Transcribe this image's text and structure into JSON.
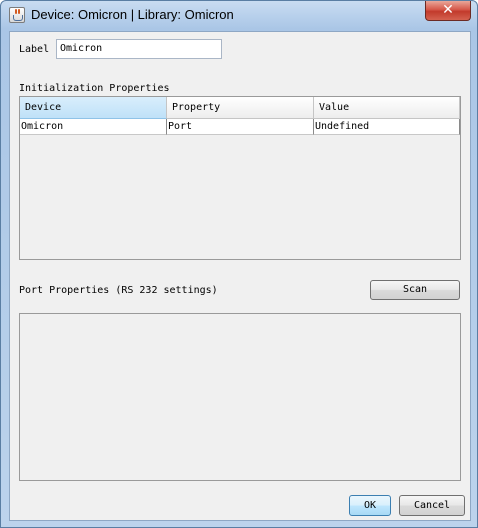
{
  "window": {
    "title": "Device: Omicron | Library: Omicron",
    "close_glyph": "✕"
  },
  "label_field": {
    "label": "Label",
    "value": "Omicron"
  },
  "init_props": {
    "heading": "Initialization Properties",
    "columns": [
      "Device",
      "Property",
      "Value"
    ],
    "rows": [
      [
        "Omicron",
        "Port",
        "Undefined"
      ]
    ]
  },
  "port_props": {
    "heading": "Port Properties (RS 232 settings)",
    "scan_label": "Scan"
  },
  "footer": {
    "ok_label": "OK",
    "cancel_label": "Cancel"
  },
  "colors": {
    "title_bar": "#b9d1ec",
    "close_button": "#c23a2c",
    "client_bg": "#f0f0f0",
    "selected_header": "#bfe1f8",
    "default_button_border": "#3c7fb1"
  }
}
